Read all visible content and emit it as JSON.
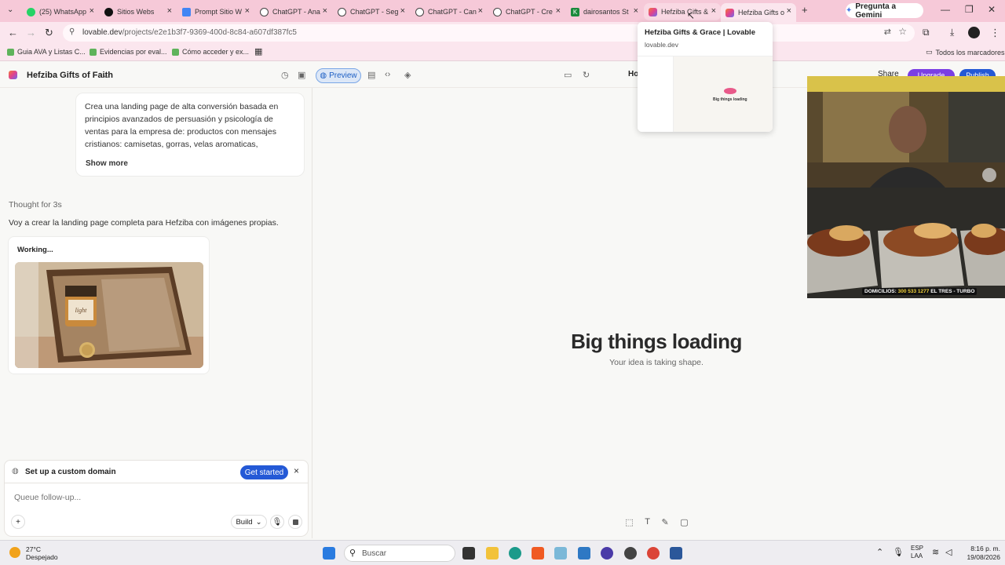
{
  "browser": {
    "tabs": [
      {
        "title": "(25) WhatsApp",
        "icon": "whatsapp-icon",
        "color": "#25d366"
      },
      {
        "title": "Sitios Webs",
        "icon": "threads-icon",
        "color": "#111111"
      },
      {
        "title": "Prompt Sitio W",
        "icon": "docs-icon",
        "color": "#4285f4"
      },
      {
        "title": "ChatGPT - Ana",
        "icon": "chatgpt-icon",
        "color": "#444444"
      },
      {
        "title": "ChatGPT - Seg",
        "icon": "chatgpt-icon",
        "color": "#444444"
      },
      {
        "title": "ChatGPT - Can",
        "icon": "chatgpt-icon",
        "color": "#444444"
      },
      {
        "title": "ChatGPT - Cre",
        "icon": "chatgpt-icon",
        "color": "#444444"
      },
      {
        "title": "dairosantos St",
        "icon": "k-icon",
        "color": "#1b8a3c"
      },
      {
        "title": "Hefziba Gifts &",
        "icon": "lovable-icon",
        "color": "#e85a8a"
      },
      {
        "title": "Hefziba Gifts o",
        "icon": "lovable-icon",
        "color": "#e85a8a"
      }
    ],
    "gemini_label": "Pregunta a Gemini",
    "url_host": "lovable.dev",
    "url_path": "/projects/e2e1b3f7-9369-400d-8c84-a607df387fc5",
    "bookmarks": [
      "Guia AVA y Listas C...",
      "Evidencias por eval...",
      "Cómo acceder y ex..."
    ],
    "bookmarks_all": "Todos los marcadores"
  },
  "hover_card": {
    "title": "Hefziba Gifts & Grace | Lovable",
    "domain": "lovable.dev",
    "thumb_text": "Big things loading"
  },
  "app": {
    "project_name": "Hefziba Gifts of Faith",
    "preview_label": "Preview",
    "route_partial": "Ho",
    "share_label": "Share",
    "upgrade_label": "Upgrade",
    "publish_label": "Publish"
  },
  "chat": {
    "prompt_text": "Crea una landing page de alta conversión basada en principios avanzados de persuasión y psicología de ventas para la empresa de: productos con mensajes cristianos: camisetas, gorras, velas aromaticas, llaveros....",
    "show_more": "Show more",
    "thought": "Thought for 3s",
    "reply": "Voy a crear la landing page completa para Hefziba con imágenes propias.",
    "working": "Working...",
    "photo_caption": "light"
  },
  "domain_banner": {
    "text": "Set up a custom domain",
    "cta": "Get started"
  },
  "composer": {
    "placeholder": "Queue follow-up...",
    "build_label": "Build"
  },
  "preview": {
    "title": "Big things loading",
    "subtitle": "Your idea is taking shape."
  },
  "webcam": {
    "banner_prefix": "DOMICILIOS:",
    "banner_phone": "300 533 1277",
    "banner_suffix": "EL TRES - TURBO"
  },
  "taskbar": {
    "temperature": "27°C",
    "weather": "Despejado",
    "search": "Buscar",
    "lang1": "ESP",
    "lang2": "LAA",
    "time": "8:16 p. m.",
    "date": "19/08/2026"
  }
}
